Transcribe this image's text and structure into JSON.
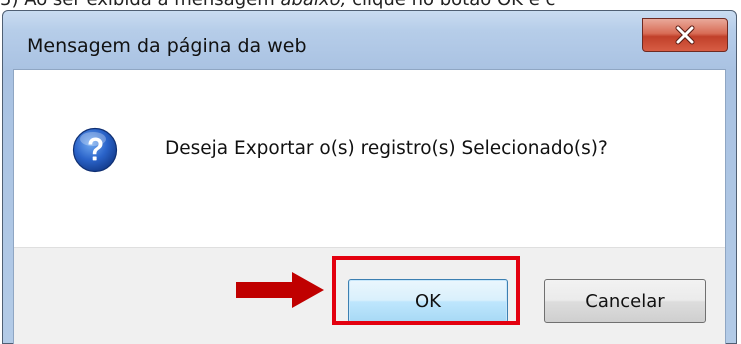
{
  "document": {
    "instruction_prefix": "5)  Ao ser exibida a mensagem ",
    "instruction_italic": "abaixo, ",
    "instruction_suffix": "clique no botão OK e c"
  },
  "dialog": {
    "title": "Mensagem da página da web",
    "message": "Deseja Exportar o(s) registro(s) Selecionado(s)?",
    "icon": "question-icon",
    "buttons": {
      "ok_label": "OK",
      "cancel_label": "Cancelar"
    }
  },
  "annotations": {
    "highlight_color": "#e3000f",
    "arrow_color": "#c00000",
    "highlighted_target": "ok-button"
  },
  "colors": {
    "titlebar": "#b6cde9",
    "close_button": "#c1402a",
    "button_area": "#f0f0f0",
    "ok_button_border": "#3c7fb1"
  }
}
